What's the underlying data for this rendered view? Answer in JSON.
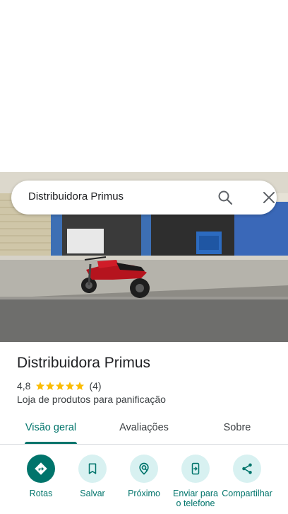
{
  "search": {
    "query": "Distribuidora Primus"
  },
  "place": {
    "name": "Distribuidora Primus",
    "rating": "4,8",
    "stars": 5,
    "review_count": "(4)",
    "category": "Loja de produtos para panificação"
  },
  "tabs": [
    {
      "label": "Visão geral",
      "active": true
    },
    {
      "label": "Avaliações",
      "active": false
    },
    {
      "label": "Sobre",
      "active": false
    }
  ],
  "actions": [
    {
      "label": "Rotas",
      "icon": "directions-icon"
    },
    {
      "label": "Salvar",
      "icon": "bookmark-icon"
    },
    {
      "label": "Próximo",
      "icon": "nearby-icon"
    },
    {
      "label": "Enviar para o telefone",
      "icon": "send-to-phone-icon"
    },
    {
      "label": "Compartilhar",
      "icon": "share-icon"
    }
  ],
  "colors": {
    "accent": "#00746b",
    "accent_light": "#d8f1f1",
    "star": "#fbbc04"
  }
}
